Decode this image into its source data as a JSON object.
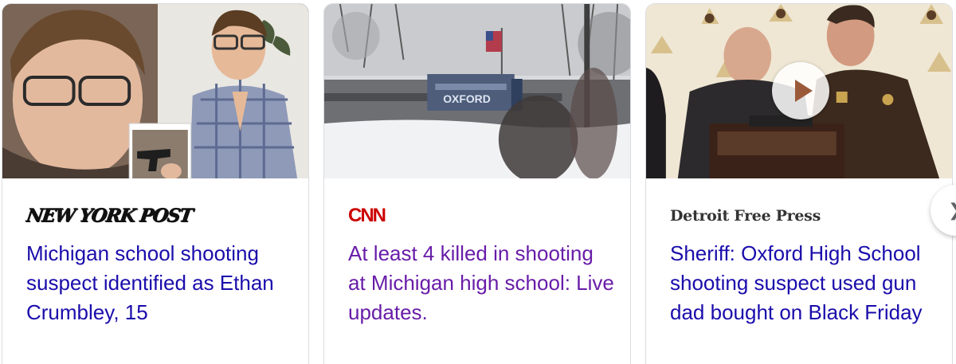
{
  "cards": [
    {
      "source": "NEW YORK POST",
      "headline": "Michigan school shooting suspect identified as Ethan Crumbley, 15",
      "visited": false,
      "has_video": false
    },
    {
      "source": "CNN",
      "headline": "At least 4 killed in shooting at Michigan high school: Live updates.",
      "visited": true,
      "has_video": false
    },
    {
      "source": "Detroit Free Press",
      "headline": "Sheriff: Oxford High School shooting suspect used gun dad bought on Black Friday",
      "visited": false,
      "has_video": true
    }
  ],
  "thumbnail_sign": "OXFORD",
  "next_icon": "chevron-right-icon",
  "colors": {
    "link": "#1a0dab",
    "visited_link": "#681da8",
    "cnn_red": "#cc0000",
    "border": "#dadce0"
  }
}
